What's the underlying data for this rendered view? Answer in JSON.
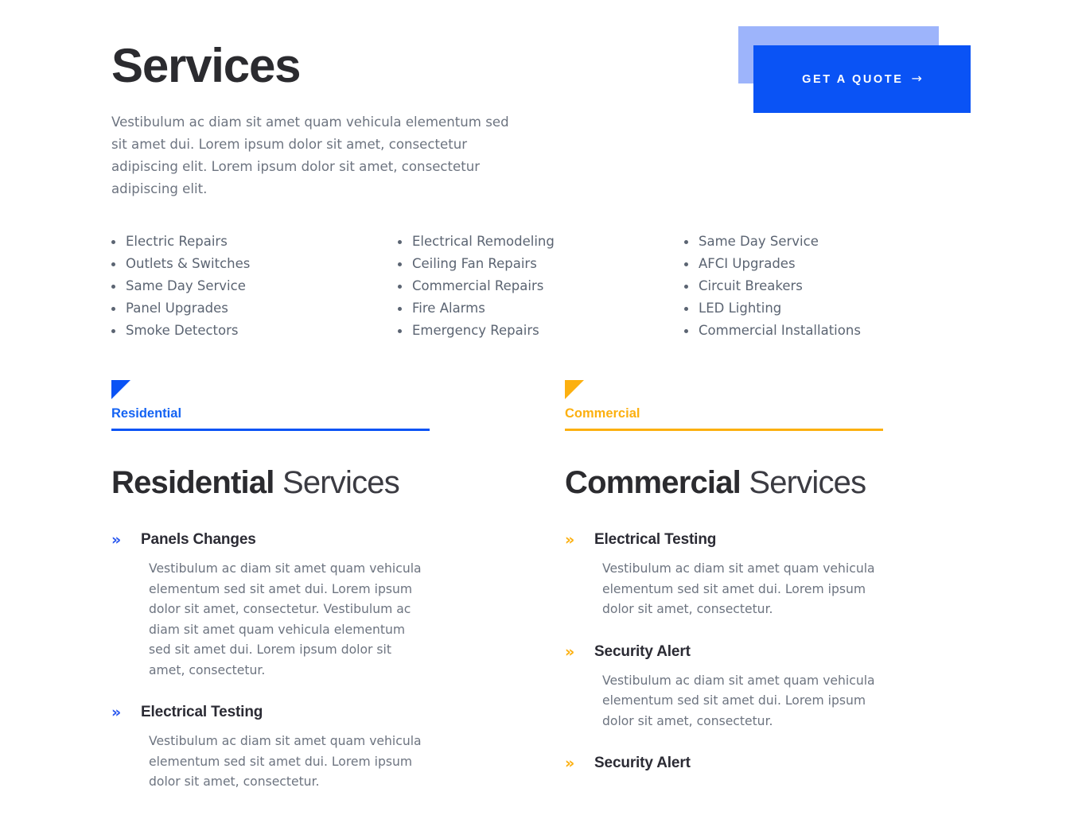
{
  "hero": {
    "title": "Services",
    "description": "Vestibulum ac diam sit amet quam vehicula elementum sed sit amet dui. Lorem ipsum dolor sit amet, consectetur adipiscing elit. Lorem ipsum dolor sit amet, consectetur adipiscing elit."
  },
  "cta": {
    "label": "GET A QUOTE",
    "arrow": "→",
    "color": "#0a53f5",
    "shadow_color": "#9db4fb"
  },
  "feature_lists": [
    {
      "items": [
        "Electric Repairs",
        "Outlets & Switches",
        "Same Day Service",
        "Panel Upgrades",
        "Smoke Detectors"
      ]
    },
    {
      "items": [
        "Electrical Remodeling",
        "Ceiling Fan Repairs",
        "Commercial Repairs",
        "Fire Alarms",
        "Emergency Repairs"
      ]
    },
    {
      "items": [
        "Same Day Service",
        "AFCI Upgrades",
        "Circuit Breakers",
        "LED Lighting",
        "Commercial Installations"
      ]
    }
  ],
  "tabs": [
    {
      "label": "Residential",
      "color": "#1463f3",
      "underline_color": "#0a53f5"
    },
    {
      "label": "Commercial",
      "color": "#fcb010",
      "underline_color": "#fcb010"
    }
  ],
  "columns": [
    {
      "heading_strong": "Residential",
      "heading_light": "Services",
      "accent_color": "#2b58ef",
      "chevron": "»",
      "services": [
        {
          "title": "Panels Changes",
          "description": "Vestibulum ac diam sit amet quam vehicula elementum sed sit amet dui. Lorem ipsum dolor sit amet, consectetur. Vestibulum ac diam sit amet quam vehicula elementum sed sit amet dui. Lorem ipsum dolor sit amet, consectetur."
        },
        {
          "title": "Electrical Testing",
          "description": "Vestibulum ac diam sit amet quam vehicula elementum sed sit amet dui. Lorem ipsum dolor sit amet, consectetur."
        }
      ]
    },
    {
      "heading_strong": "Commercial",
      "heading_light": "Services",
      "accent_color": "#fcb010",
      "chevron": "»",
      "services": [
        {
          "title": "Electrical Testing",
          "description": "Vestibulum ac diam sit amet quam vehicula elementum sed sit amet dui. Lorem ipsum dolor sit amet, consectetur."
        },
        {
          "title": "Security Alert",
          "description": "Vestibulum ac diam sit amet quam vehicula elementum sed sit amet dui. Lorem ipsum dolor sit amet, consectetur."
        },
        {
          "title": "Security Alert",
          "description": ""
        }
      ]
    }
  ]
}
